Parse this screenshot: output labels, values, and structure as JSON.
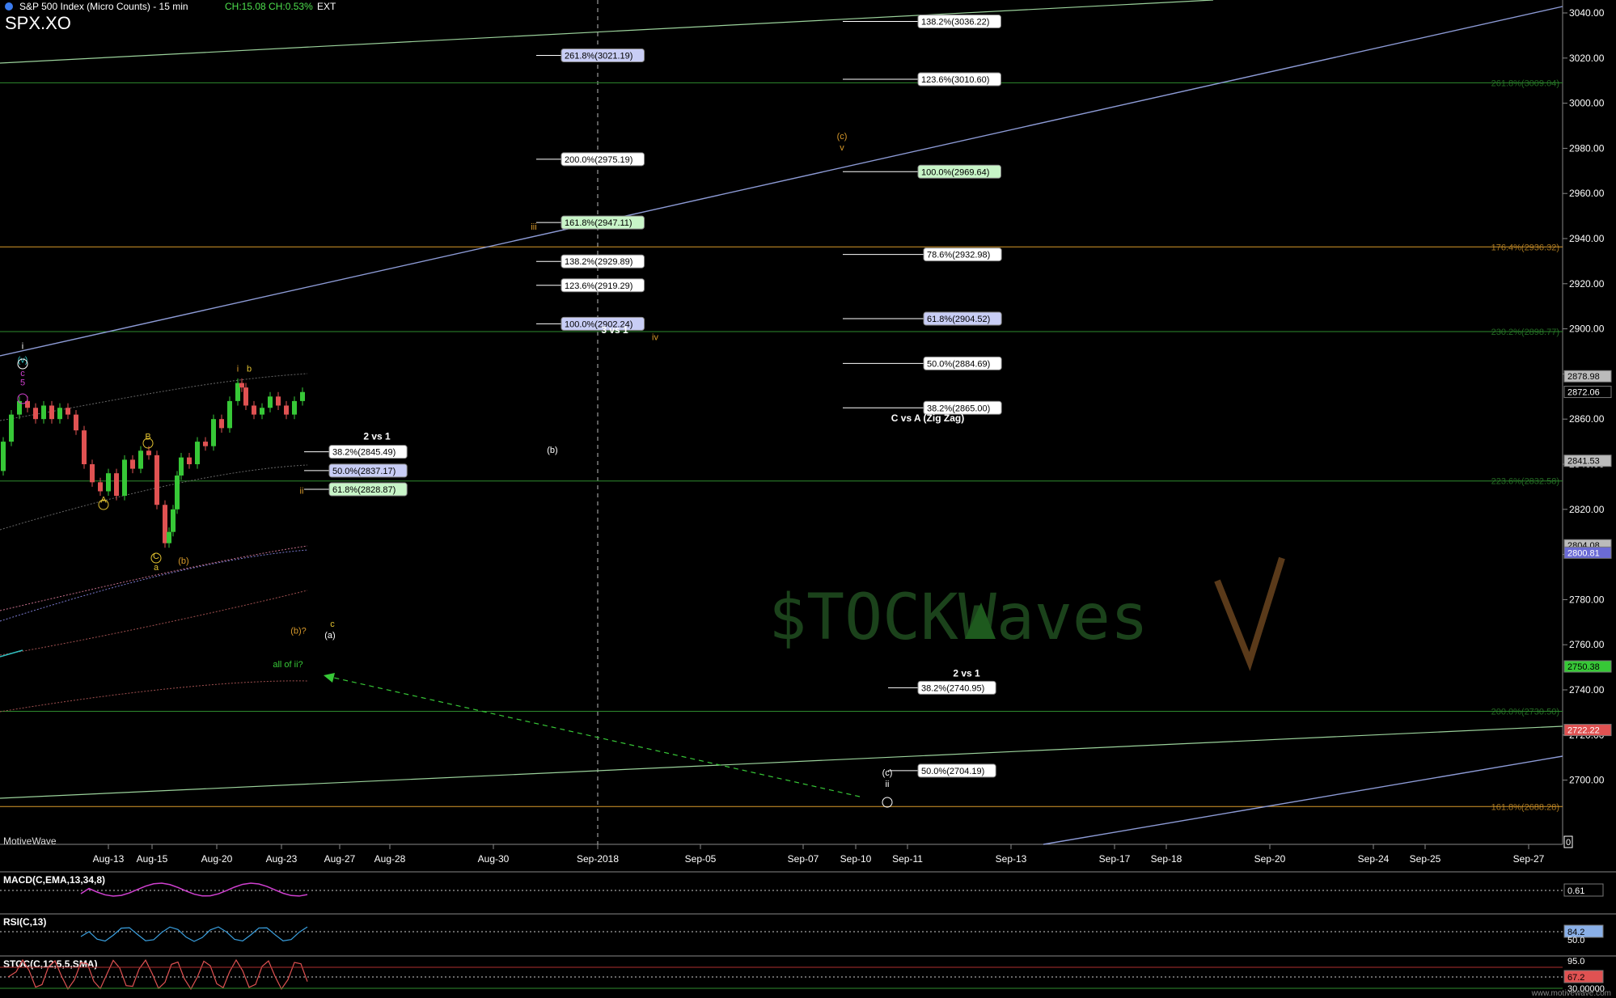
{
  "header": {
    "title": "S&P 500 Index (Micro Counts) - 15 min",
    "change": "CH:15.08",
    "change_pct": "CH:0.53%",
    "session": "EXT",
    "symbol": "SPX.XO"
  },
  "brand_label": "MotiveWave",
  "footer_text": "www.motivewave.com",
  "watermark": "$TOCKWaves",
  "colors": {
    "background": "#000000",
    "green_line": "#2e8b2e",
    "orange_line": "#d99a2b",
    "blue_line": "#8d9bd6",
    "up_candle": "#37c837",
    "down_candle": "#e05252"
  },
  "chart_data": {
    "type": "line",
    "title": "S&P 500 Index (Micro Counts) - 15 min",
    "ylim": [
      2680,
      3045
    ],
    "y_ticks": [
      3040,
      3020,
      3000,
      2980,
      2960,
      2940,
      2920,
      2900,
      2880,
      2860,
      2840,
      2820,
      2800,
      2780,
      2760,
      2740,
      2720,
      2700
    ],
    "x_ticks": [
      "Aug-13",
      "Aug-15",
      "Aug-20",
      "Aug-23",
      "Aug-27",
      "Aug-28",
      "Aug-30",
      "Sep-2018",
      "Sep-05",
      "Sep-07",
      "Sep-10",
      "Sep-11",
      "Sep-13",
      "Sep-17",
      "Sep-18",
      "Sep-20",
      "Sep-24",
      "Sep-25",
      "Sep-27"
    ],
    "price_path": [
      [
        0,
        2837
      ],
      [
        10,
        2850
      ],
      [
        20,
        2862
      ],
      [
        30,
        2868
      ],
      [
        40,
        2865
      ],
      [
        50,
        2860
      ],
      [
        60,
        2866
      ],
      [
        70,
        2860
      ],
      [
        80,
        2865
      ],
      [
        90,
        2862
      ],
      [
        100,
        2855
      ],
      [
        110,
        2840
      ],
      [
        120,
        2832
      ],
      [
        130,
        2828
      ],
      [
        140,
        2836
      ],
      [
        150,
        2826
      ],
      [
        160,
        2842
      ],
      [
        170,
        2838
      ],
      [
        180,
        2846
      ],
      [
        190,
        2844
      ],
      [
        200,
        2822
      ],
      [
        205,
        2805
      ],
      [
        210,
        2810
      ],
      [
        215,
        2820
      ],
      [
        220,
        2835
      ],
      [
        230,
        2843
      ],
      [
        240,
        2840
      ],
      [
        250,
        2850
      ],
      [
        260,
        2848
      ],
      [
        270,
        2860
      ],
      [
        280,
        2856
      ],
      [
        290,
        2868
      ],
      [
        295,
        2876
      ],
      [
        300,
        2874
      ],
      [
        310,
        2866
      ],
      [
        320,
        2862
      ],
      [
        330,
        2865
      ],
      [
        340,
        2870
      ],
      [
        350,
        2866
      ],
      [
        360,
        2862
      ],
      [
        370,
        2868
      ],
      [
        380,
        2872
      ]
    ],
    "axis_badges": [
      {
        "value": "2878.98",
        "y": 2878.98,
        "color": "#bbbbbb",
        "text": "#000"
      },
      {
        "value": "2872.06",
        "y": 2872.06,
        "color": "#000000",
        "text": "#fff"
      },
      {
        "value": "2841.53",
        "y": 2841.53,
        "color": "#bbbbbb",
        "text": "#000"
      },
      {
        "value": "2804.08",
        "y": 2804.08,
        "color": "#bbbbbb",
        "text": "#000"
      },
      {
        "value": "2800.81",
        "y": 2800.81,
        "color": "#6b6bd6",
        "text": "#fff"
      },
      {
        "value": "2750.38",
        "y": 2750.38,
        "color": "#37c837",
        "text": "#000"
      },
      {
        "value": "2722.22",
        "y": 2722.22,
        "color": "#e05252",
        "text": "#fff"
      },
      {
        "value": "0",
        "y": null,
        "color": "#000000",
        "text": "#fff"
      }
    ],
    "horizontal_levels": [
      {
        "label": "261.8%(3009.04)",
        "y": 3009.04,
        "color": "#2e8b2e"
      },
      {
        "label": "176.4%(2936.32)",
        "y": 2936.32,
        "color": "#d99a2b"
      },
      {
        "label": "230.2%(2898.77)",
        "y": 2898.77,
        "color": "#2e8b2e"
      },
      {
        "label": "223.6%(2832.58)",
        "y": 2832.58,
        "color": "#2e8b2e"
      },
      {
        "label": "200.0%(2730.50)",
        "y": 2730.5,
        "color": "#2e8b2e"
      },
      {
        "label": "161.8%(2688.28)",
        "y": 2688.28,
        "color": "#d99a2b"
      }
    ],
    "fib_boxes": [
      {
        "label": "138.2%(3036.22)",
        "y": 3036.22,
        "col": "mid",
        "fill": "#ffffff"
      },
      {
        "label": "261.8%(3021.19)",
        "y": 3021.19,
        "col": "left",
        "fill": "#c8cdf5"
      },
      {
        "label": "123.6%(3010.60)",
        "y": 3010.6,
        "col": "mid",
        "fill": "#ffffff"
      },
      {
        "label": "200.0%(2975.19)",
        "y": 2975.19,
        "col": "left",
        "fill": "#ffffff"
      },
      {
        "label": "100.0%(2969.64)",
        "y": 2969.64,
        "col": "mid",
        "fill": "#c8f5c8"
      },
      {
        "label": "161.8%(2947.11)",
        "y": 2947.11,
        "col": "left",
        "fill": "#c8f5c8"
      },
      {
        "label": "78.6%(2932.98)",
        "y": 2932.98,
        "col": "mid",
        "fill": "#ffffff"
      },
      {
        "label": "138.2%(2929.89)",
        "y": 2929.89,
        "col": "left",
        "fill": "#ffffff"
      },
      {
        "label": "123.6%(2919.29)",
        "y": 2919.29,
        "col": "left",
        "fill": "#ffffff"
      },
      {
        "label": "61.8%(2904.52)",
        "y": 2904.52,
        "col": "mid",
        "fill": "#c8cdf5"
      },
      {
        "label": "100.0%(2902.24)",
        "y": 2902.24,
        "col": "left",
        "fill": "#c8cdf5"
      },
      {
        "label": "50.0%(2884.69)",
        "y": 2884.69,
        "col": "mid",
        "fill": "#ffffff"
      },
      {
        "label": "38.2%(2865.00)",
        "y": 2865.0,
        "col": "mid",
        "fill": "#ffffff"
      },
      {
        "label": "38.2%(2845.49)",
        "y": 2845.49,
        "col": "near",
        "fill": "#ffffff"
      },
      {
        "label": "50.0%(2837.17)",
        "y": 2837.17,
        "col": "near",
        "fill": "#c8cdf5"
      },
      {
        "label": "61.8%(2828.87)",
        "y": 2828.87,
        "col": "near",
        "fill": "#c8f5c8"
      },
      {
        "label": "38.2%(2740.95)",
        "y": 2740.95,
        "col": "low",
        "fill": "#ffffff"
      },
      {
        "label": "50.0%(2704.19)",
        "y": 2704.19,
        "col": "low",
        "fill": "#ffffff"
      }
    ],
    "annotations": [
      {
        "text": "3 vs 1",
        "y": 2898,
        "col": "left_note",
        "color": "#ffffff"
      },
      {
        "text": "C vs A (Zig Zag)",
        "y": 2859,
        "col": "mid_note",
        "color": "#ffffff"
      },
      {
        "text": "2 vs 1",
        "y": 2851,
        "col": "near_note",
        "color": "#ffffff"
      },
      {
        "text": "2 vs 1",
        "y": 2746,
        "col": "low_note",
        "color": "#ffffff"
      },
      {
        "text": "all of ii?",
        "y": 2750,
        "col": "green_note",
        "color": "#37c837"
      },
      {
        "text": "(c)",
        "y": 2984,
        "col": "c_wave",
        "color": "#d99a2b"
      },
      {
        "text": "v",
        "y": 2979,
        "col": "c_wave",
        "color": "#d99a2b"
      },
      {
        "text": "iii",
        "y": 2944,
        "col": "iii",
        "color": "#d99a2b"
      },
      {
        "text": "iv",
        "y": 2895,
        "col": "iv",
        "color": "#d99a2b"
      },
      {
        "text": "(b)",
        "y": 2845,
        "col": "b_white",
        "color": "#ffffff"
      },
      {
        "text": "ii",
        "y": 2827,
        "col": "ii",
        "color": "#d99a2b"
      },
      {
        "text": "(b)?",
        "y": 2765,
        "col": "b_q",
        "color": "#d99a2b"
      },
      {
        "text": "c",
        "y": 2768,
        "col": "c_small",
        "color": "#e0c030"
      },
      {
        "text": "(a)",
        "y": 2763,
        "col": "a_white",
        "color": "#ffffff"
      },
      {
        "text": "(c)",
        "y": 2702,
        "col": "c_low",
        "color": "#ffffff"
      },
      {
        "text": "ii",
        "y": 2697,
        "col": "c_low",
        "color": "#ffffff"
      },
      {
        "text": "i",
        "y": 2881,
        "col": "i_top",
        "color": "#d99a2b"
      },
      {
        "text": "b",
        "y": 2881,
        "col": "b_top",
        "color": "#e0c030"
      },
      {
        "text": "i",
        "y": 2891,
        "col": "start",
        "color": "#ffffff"
      },
      {
        "text": "(v)",
        "y": 2885,
        "col": "start",
        "color": "#30c0c0"
      },
      {
        "text": "c",
        "y": 2879,
        "col": "start",
        "color": "#d040d0"
      },
      {
        "text": "5",
        "y": 2875,
        "col": "start",
        "color": "#d040d0"
      },
      {
        "text": "A",
        "y": 2823,
        "col": "A_mark",
        "color": "#e0c030"
      },
      {
        "text": "B",
        "y": 2851,
        "col": "B_mark",
        "color": "#e0c030"
      },
      {
        "text": "C",
        "y": 2798,
        "col": "C_mark",
        "color": "#e0c030"
      },
      {
        "text": "a",
        "y": 2793,
        "col": "C_mark",
        "color": "#e0c030"
      },
      {
        "text": "(b)",
        "y": 2796,
        "col": "b_small",
        "color": "#d99a2b"
      }
    ],
    "indicators": [
      {
        "name": "MACD(C,EMA,13,34,8)",
        "value": "0.61",
        "badge_color": "#000000"
      },
      {
        "name": "RSI(C,13)",
        "value": "84.2",
        "badge_color": "#8ab0e8"
      },
      {
        "name": "STOC(C,12,5,5,SMA)",
        "value": "67.2",
        "badge_color": "#e05252"
      }
    ],
    "indicator_secondary": [
      {
        "value": "50.0",
        "panel": 1
      },
      {
        "value": "95.0",
        "panel": 2
      },
      {
        "value": "30.00000",
        "panel": 2
      }
    ]
  }
}
